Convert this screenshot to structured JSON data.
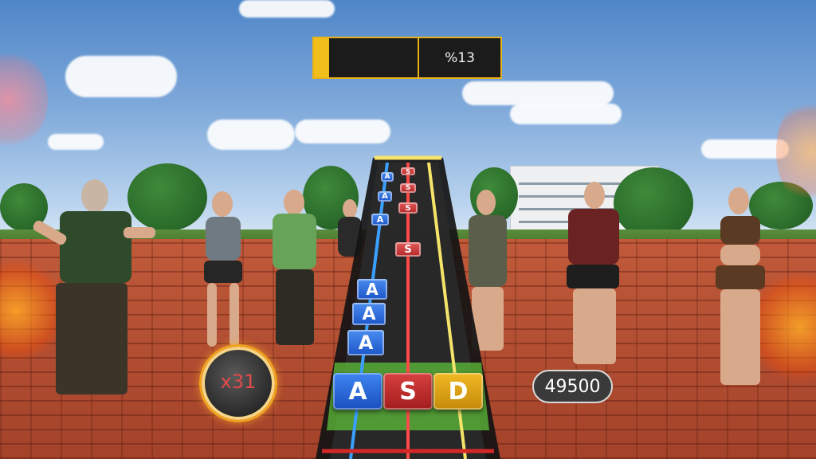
{
  "progress": {
    "fill_fraction": 0.13,
    "label": "%13",
    "accent": "#f1be1c"
  },
  "lanes": [
    {
      "key": "A",
      "color": "#2f6fe0"
    },
    {
      "key": "S",
      "color": "#d13636"
    },
    {
      "key": "D",
      "color": "#e2a818"
    }
  ],
  "notes": [
    {
      "lane": "A",
      "label": "A"
    },
    {
      "lane": "A",
      "label": "A"
    },
    {
      "lane": "A",
      "label": "A"
    },
    {
      "lane": "A",
      "label": "A"
    },
    {
      "lane": "A",
      "label": "A"
    },
    {
      "lane": "A",
      "label": "A"
    },
    {
      "lane": "S",
      "label": "S"
    },
    {
      "lane": "S",
      "label": "S"
    },
    {
      "lane": "S",
      "label": "S"
    },
    {
      "lane": "S",
      "label": "S"
    }
  ],
  "combo": {
    "label": "x31"
  },
  "score": {
    "value": "49500"
  }
}
